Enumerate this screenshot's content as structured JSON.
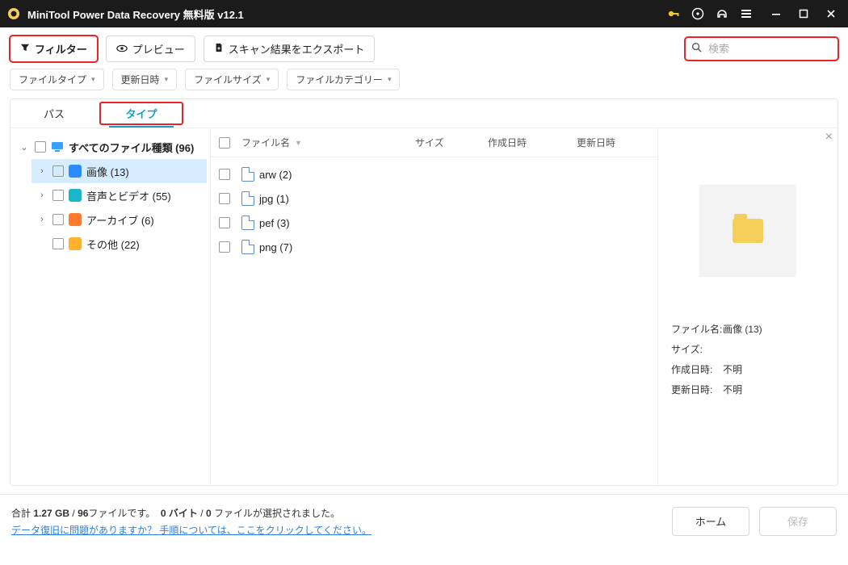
{
  "titlebar": {
    "title": "MiniTool Power Data Recovery 無料版 v12.1"
  },
  "toolbar": {
    "filter_label": "フィルター",
    "preview_label": "プレビュー",
    "export_label": "スキャン結果をエクスポート",
    "search_placeholder": "検索"
  },
  "filters": {
    "filetype": "ファイルタイプ",
    "mtime": "更新日時",
    "filesize": "ファイルサイズ",
    "category": "ファイルカテゴリー"
  },
  "tabs": {
    "path": "パス",
    "type": "タイプ"
  },
  "tree": {
    "root": "すべてのファイル種類 (96)",
    "items": [
      {
        "label": "画像 (13)"
      },
      {
        "label": "音声とビデオ (55)"
      },
      {
        "label": "アーカイブ (6)"
      },
      {
        "label": "その他 (22)"
      }
    ]
  },
  "columns": {
    "name": "ファイル名",
    "size": "サイズ",
    "ctime": "作成日時",
    "mtime": "更新日時"
  },
  "files": [
    {
      "name": "arw (2)"
    },
    {
      "name": "jpg (1)"
    },
    {
      "name": "pef (3)"
    },
    {
      "name": "png (7)"
    }
  ],
  "preview": {
    "name_label": "ファイル名:",
    "name_value": "画像 (13)",
    "size_label": "サイズ:",
    "size_value": "",
    "ctime_label": "作成日時:",
    "ctime_value": "不明",
    "mtime_label": "更新日時:",
    "mtime_value": "不明"
  },
  "footer": {
    "total_prefix": "合計 ",
    "total_size": "1.27 GB",
    "sep": " / ",
    "total_files_suffix": "ファイルです。",
    "total_files": "96",
    "sel_bytes": "0 バイト",
    "sel_sep": " / ",
    "sel_files": "0",
    "sel_suffix": " ファイルが選択されました。",
    "help_link": "データ復旧に問題がありますか？ 手順については、ここをクリックしてください。",
    "home": "ホーム",
    "save": "保存"
  }
}
